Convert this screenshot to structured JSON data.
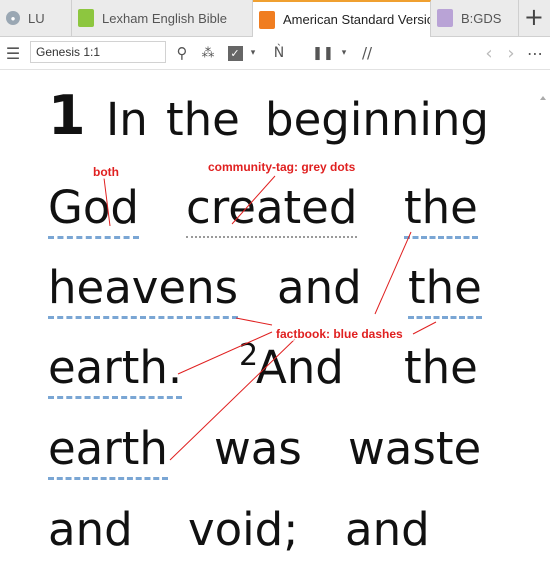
{
  "tabs": [
    {
      "label": "LU",
      "icon": "circle-book-icon",
      "color": "#9aa7b3"
    },
    {
      "label": "Lexham English Bible",
      "icon": "green-book-icon",
      "color": "#8dc63f"
    },
    {
      "label": "American Standard Version",
      "icon": "orange-book-icon",
      "color": "#f07d20",
      "active": true
    },
    {
      "label": "B:GDS",
      "icon": "purple-book-icon",
      "color": "#b9a3d6"
    }
  ],
  "toolbar": {
    "reference": "Genesis 1:1"
  },
  "verse": {
    "number": "1",
    "words": {
      "in": "In",
      "the1": "the",
      "beginning": "beginning",
      "god": "God",
      "created": "created",
      "the2": "the",
      "heavens": "heavens",
      "and1": "and",
      "the3": "the",
      "earth1": "earth.",
      "v2": "2",
      "and2": "And",
      "the4": "the",
      "earth2": "earth",
      "was": "was",
      "waste": "waste",
      "and3": "and",
      "void": "void;",
      "and4": "and"
    }
  },
  "annotations": {
    "both": "both",
    "community": "community-tag: grey dots",
    "factbook": "factbook: blue dashes"
  },
  "colors": {
    "annotation": "#e02020",
    "factbook_dash": "#7aa6d4",
    "community_dot": "#9a9a9a",
    "active_tab_accent": "#f0a030"
  }
}
